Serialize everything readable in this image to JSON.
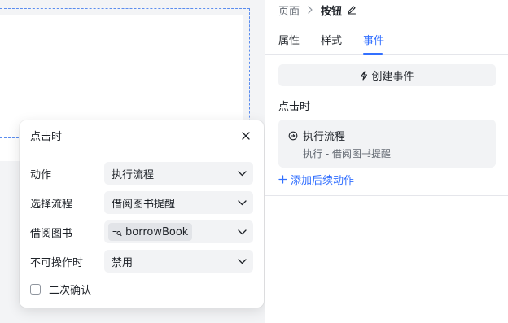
{
  "breadcrumb": {
    "parent": "页面",
    "current": "按钮"
  },
  "tabs": [
    {
      "label": "属性",
      "active": false
    },
    {
      "label": "样式",
      "active": false
    },
    {
      "label": "事件",
      "active": true
    }
  ],
  "events_panel": {
    "create_button_label": "创建事件",
    "section_title": "点击时",
    "event_card": {
      "title": "执行流程",
      "subtitle": "执行 - 借阅图书提醒"
    },
    "add_action_label": "添加后续动作"
  },
  "popover": {
    "title": "点击时",
    "fields": [
      {
        "label": "动作",
        "value": "执行流程"
      },
      {
        "label": "选择流程",
        "value": "借阅图书提醒"
      },
      {
        "label": "借阅图书",
        "value": "borrowBook"
      },
      {
        "label": "不可操作时",
        "value": "禁用"
      }
    ],
    "checkbox": {
      "label": "二次确认",
      "checked": false
    }
  },
  "colors": {
    "accent": "#3370ff",
    "text": "#1f2329",
    "muted": "#646a73",
    "field_bg": "#f2f3f5"
  }
}
